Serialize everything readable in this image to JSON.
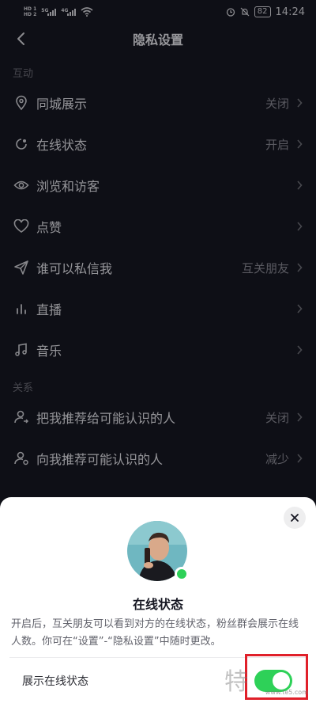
{
  "status_bar": {
    "hd1": "HD 1",
    "hd2": "HD 2",
    "net1": "5G",
    "net2": "4G",
    "battery": "82",
    "time": "14:24"
  },
  "nav": {
    "title": "隐私设置"
  },
  "sections": [
    {
      "title": "互动",
      "items": [
        {
          "label": "同城展示",
          "value": "关闭",
          "icon": "location-pin-icon"
        },
        {
          "label": "在线状态",
          "value": "开启",
          "icon": "online-status-icon"
        },
        {
          "label": "浏览和访客",
          "value": "",
          "icon": "eye-icon"
        },
        {
          "label": "点赞",
          "value": "",
          "icon": "heart-icon"
        },
        {
          "label": "谁可以私信我",
          "value": "互关朋友",
          "icon": "paper-plane-icon"
        },
        {
          "label": "直播",
          "value": "",
          "icon": "bars-icon"
        },
        {
          "label": "音乐",
          "value": "",
          "icon": "music-note-icon"
        }
      ]
    },
    {
      "title": "关系",
      "items": [
        {
          "label": "把我推荐给可能认识的人",
          "value": "关闭",
          "icon": "user-share-icon"
        },
        {
          "label": "向我推荐可能认识的人",
          "value": "减少",
          "icon": "user-recommend-icon"
        }
      ]
    }
  ],
  "sheet": {
    "title": "在线状态",
    "description": "开启后，互关朋友可以看到对方的在线状态，粉丝群会展示在线人数。你可在“设置”-“隐私设置”中随时更改。",
    "toggle_label": "展示在线状态",
    "toggle_on": true
  },
  "watermark": {
    "text": "特玩",
    "url": "www.te5.com"
  },
  "colors": {
    "background": "#161722",
    "sheet": "#ffffff",
    "toggle_on": "#2ed158",
    "highlight": "#e0202a"
  }
}
